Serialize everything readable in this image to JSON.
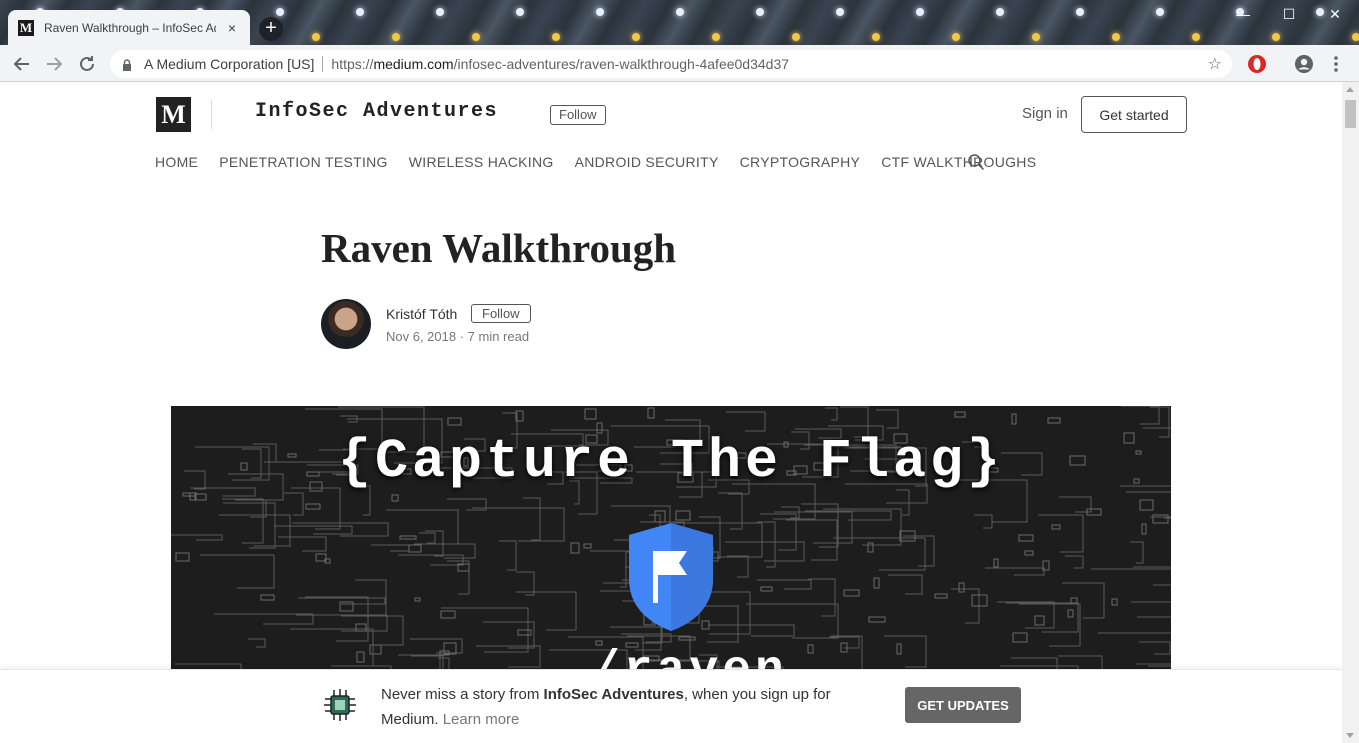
{
  "browser": {
    "tab_title": "Raven Walkthrough – InfoSec Ad",
    "tab_close": "×",
    "new_tab": "+",
    "site_org": "A Medium Corporation [US]",
    "url_scheme": "https://",
    "url_host": "medium.com",
    "url_path": "/infosec-adventures/raven-walkthrough-4afee0d34d37",
    "controls": {
      "minimize": "—",
      "maximize": "☐",
      "close": "✕"
    }
  },
  "publication": {
    "logo_letter": "M",
    "name": "InfoSec Adventures",
    "follow_label": "Follow",
    "sign_in": "Sign in",
    "get_started": "Get started",
    "nav": [
      "HOME",
      "PENETRATION TESTING",
      "WIRELESS HACKING",
      "ANDROID SECURITY",
      "CRYPTOGRAPHY",
      "CTF WALKTHROUGHS"
    ]
  },
  "article": {
    "title": "Raven Walkthrough",
    "author": "Kristóf Tóth",
    "author_follow": "Follow",
    "meta": "Nov 6, 2018 · 7 min read",
    "hero_heading": "{Capture The Flag}",
    "hero_sub": "/raven"
  },
  "banner": {
    "text_before": "Never miss a story from ",
    "publication": "InfoSec Adventures",
    "text_after": ", when you sign up for Medium. ",
    "learn_more": "Learn more",
    "cta": "GET UPDATES"
  },
  "colors": {
    "shield": "#4285f4",
    "cta_bg": "#666666"
  }
}
